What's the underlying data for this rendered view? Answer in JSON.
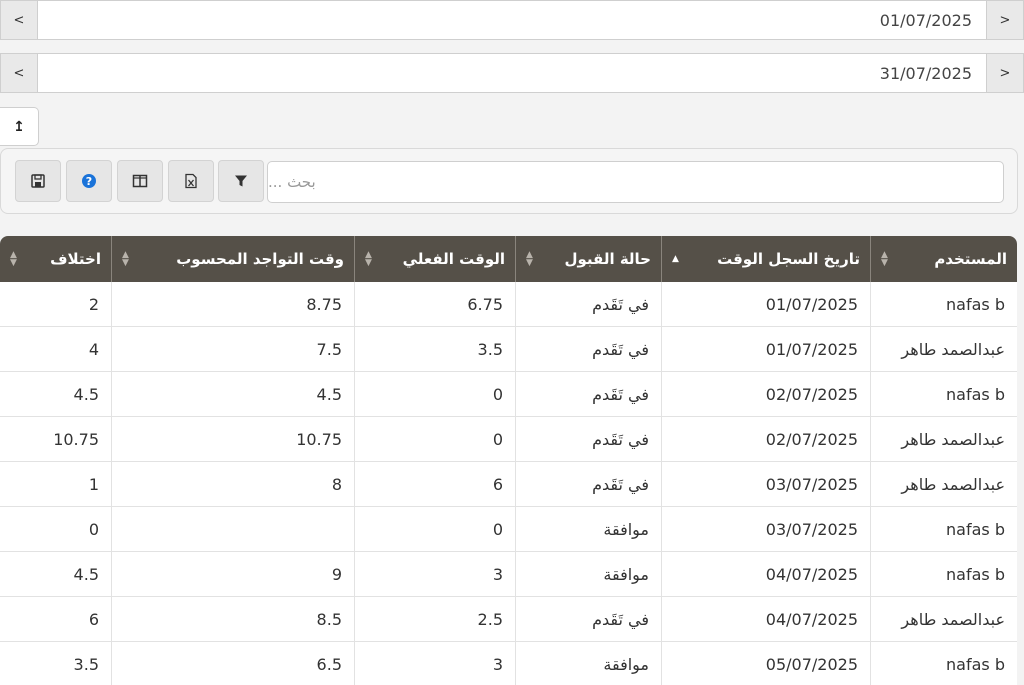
{
  "filters": {
    "start_date": "01/07/2025",
    "end_date": "31/07/2025",
    "prev_label": "<",
    "next_label": ">"
  },
  "export_icon_label": "↥",
  "toolbar": {
    "search_placeholder": "بحث ...",
    "buttons": [
      "save-icon",
      "help-icon",
      "columns-icon",
      "excel-icon",
      "filter-icon"
    ]
  },
  "grid": {
    "headers": [
      "المستخدم",
      "تاريخ السجل الوقت",
      "حالة القبول",
      "الوقت الفعلي",
      "وقت التواجد المحسوب",
      "اختلاف"
    ],
    "rows": [
      [
        "nafas b",
        "01/07/2025",
        "في تَقَدم",
        "6.75",
        "8.75",
        "2"
      ],
      [
        "عبدالصمد طاهر",
        "01/07/2025",
        "في تَقَدم",
        "3.5",
        "7.5",
        "4"
      ],
      [
        "nafas b",
        "02/07/2025",
        "في تَقَدم",
        "0",
        "4.5",
        "4.5"
      ],
      [
        "عبدالصمد طاهر",
        "02/07/2025",
        "في تَقَدم",
        "0",
        "10.75",
        "10.75"
      ],
      [
        "عبدالصمد طاهر",
        "03/07/2025",
        "في تَقَدم",
        "6",
        "8",
        "1"
      ],
      [
        "nafas b",
        "03/07/2025",
        "موافقة",
        "0",
        "",
        "0"
      ],
      [
        "nafas b",
        "04/07/2025",
        "موافقة",
        "3",
        "9",
        "4.5"
      ],
      [
        "عبدالصمد طاهر",
        "04/07/2025",
        "في تَقَدم",
        "2.5",
        "8.5",
        "6"
      ],
      [
        "nafas b",
        "05/07/2025",
        "موافقة",
        "3",
        "6.5",
        "3.5"
      ]
    ],
    "approved_color": "#1a8f1a",
    "header_color": "#555048"
  }
}
